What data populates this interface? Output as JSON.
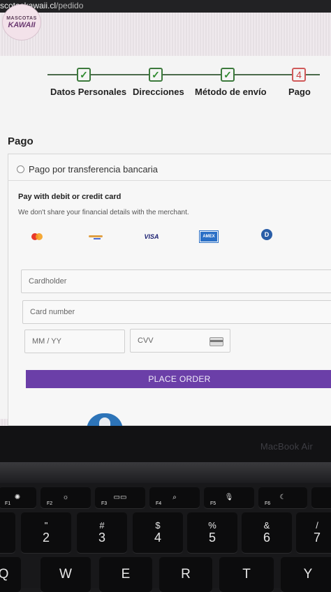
{
  "url": {
    "host": "scotaskawaii.cl",
    "path": "/pedido"
  },
  "logo": {
    "line1": "MASCOTAS",
    "line2": "KAWAII"
  },
  "steps": [
    {
      "label": "Datos Personales",
      "mark": "✓"
    },
    {
      "label": "Direcciones",
      "mark": "✓"
    },
    {
      "label": "Método de envío",
      "mark": "✓"
    },
    {
      "label": "Pago",
      "mark": "4"
    }
  ],
  "payment": {
    "section_title": "Pago",
    "bank_transfer_label": "Pago por transferencia bancaria",
    "card_title": "Pay with debit or credit card",
    "card_subtitle": "We don't share your financial details with the merchant.",
    "brands": {
      "visa": "VISA",
      "amex": "AMEX",
      "diners": "D"
    },
    "cardholder_placeholder": "Cardholder",
    "card_number_placeholder": "Card number",
    "expiry_placeholder": "MM / YY",
    "cvv_placeholder": "CVV",
    "place_order_label": "PLACE ORDER"
  },
  "device": {
    "label": "MacBook Air"
  },
  "keyboard": {
    "fkeys": [
      {
        "icon": "✺",
        "label": "F1"
      },
      {
        "icon": "☼",
        "label": "F2"
      },
      {
        "icon": "▭▭",
        "label": "F3"
      },
      {
        "icon": "⌕",
        "label": "F4"
      },
      {
        "icon": "🎙",
        "label": "F5"
      },
      {
        "icon": "☾",
        "label": "F6"
      }
    ],
    "numkeys": [
      {
        "sym": "\"",
        "dig": "2"
      },
      {
        "sym": "#",
        "dig": "3"
      },
      {
        "sym": "$",
        "dig": "4"
      },
      {
        "sym": "%",
        "dig": "5"
      },
      {
        "sym": "&",
        "dig": "6"
      },
      {
        "sym": "/",
        "dig": "7"
      }
    ],
    "letters": [
      "Q",
      "W",
      "E",
      "R",
      "T",
      "Y"
    ]
  },
  "colors": {
    "accent": "#6b3fa8",
    "check": "#2e8a2e",
    "step_current": "#c44"
  }
}
